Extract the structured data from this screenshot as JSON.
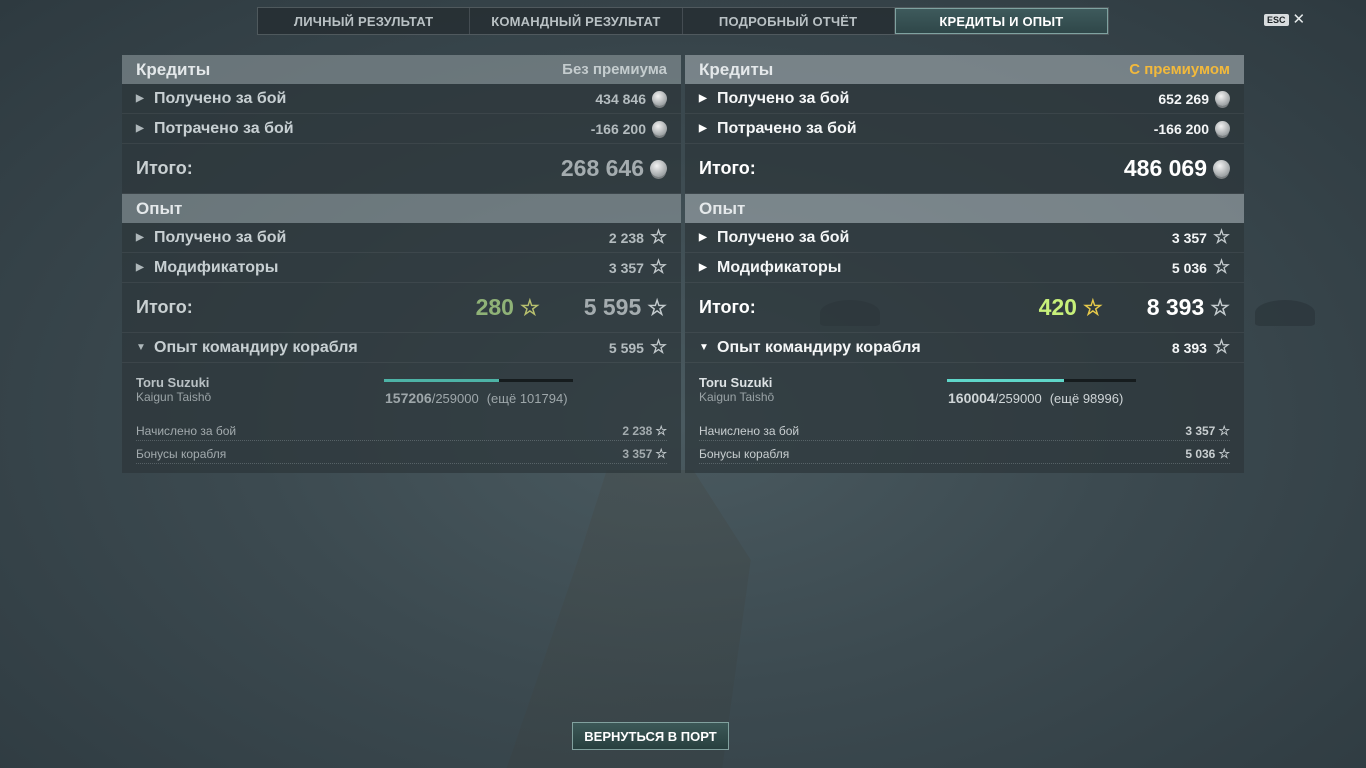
{
  "tabs": [
    {
      "label": "ЛИЧНЫЙ РЕЗУЛЬТАТ"
    },
    {
      "label": "КОМАНДНЫЙ РЕЗУЛЬТАТ"
    },
    {
      "label": "ПОДРОБНЫЙ ОТЧЁТ"
    },
    {
      "label": "КРЕДИТЫ И ОПЫТ",
      "active": true
    }
  ],
  "esc": {
    "key": "ESC",
    "close": "✕"
  },
  "panels": {
    "left": {
      "credits_header": "Кредиты",
      "mode": "Без премиума",
      "credits_earned_label": "Получено за бой",
      "credits_earned": "434 846",
      "credits_spent_label": "Потрачено за бой",
      "credits_spent": "-166 200",
      "credits_total_label": "Итого:",
      "credits_total": "268 646",
      "xp_header": "Опыт",
      "xp_earned_label": "Получено за бой",
      "xp_earned": "2 238",
      "xp_mod_label": "Модификаторы",
      "xp_mod": "3 357",
      "xp_total_label": "Итого:",
      "xp_free": "280",
      "xp_total": "5 595",
      "cmd_header_label": "Опыт командиру корабля",
      "cmd_xp": "5 595",
      "cmd_name": "Toru Suzuki",
      "cmd_rank": "Kaigun Taishō",
      "cmd_progress_fraction": 0.607,
      "cmd_current": "157206",
      "cmd_max": "/259000",
      "cmd_remaining": "(ещё 101794)",
      "cmd_battle_label": "Начислено за бой",
      "cmd_battle": "2 238",
      "cmd_bonus_label": "Бонусы корабля",
      "cmd_bonus": "3 357"
    },
    "right": {
      "credits_header": "Кредиты",
      "mode": "С премиумом",
      "credits_earned_label": "Получено за бой",
      "credits_earned": "652 269",
      "credits_spent_label": "Потрачено за бой",
      "credits_spent": "-166 200",
      "credits_total_label": "Итого:",
      "credits_total": "486 069",
      "xp_header": "Опыт",
      "xp_earned_label": "Получено за бой",
      "xp_earned": "3 357",
      "xp_mod_label": "Модификаторы",
      "xp_mod": "5 036",
      "xp_total_label": "Итого:",
      "xp_free": "420",
      "xp_total": "8 393",
      "cmd_header_label": "Опыт командиру корабля",
      "cmd_xp": "8 393",
      "cmd_name": "Toru Suzuki",
      "cmd_rank": "Kaigun Taishō",
      "cmd_progress_fraction": 0.618,
      "cmd_current": "160004",
      "cmd_max": "/259000",
      "cmd_remaining": "(ещё 98996)",
      "cmd_battle_label": "Начислено за бой",
      "cmd_battle": "3 357",
      "cmd_bonus_label": "Бонусы корабля",
      "cmd_bonus": "5 036"
    }
  },
  "back_button": "ВЕРНУТЬСЯ В ПОРТ",
  "icons": {
    "coin": "credits-coin-icon",
    "star": "xp-star-icon",
    "expand": "triangle-right-icon",
    "collapse": "triangle-down-icon"
  },
  "colors": {
    "premium": "#f2b93c",
    "accent": "#5fd6c9",
    "free_xp": "#c7f07a"
  }
}
